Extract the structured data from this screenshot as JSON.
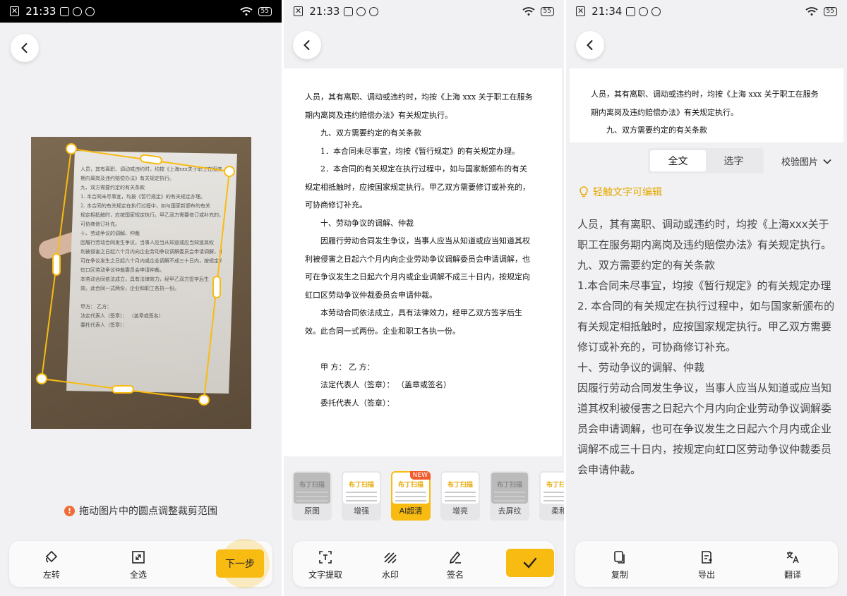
{
  "screen1": {
    "status": {
      "time": "21:33",
      "battery": "55"
    },
    "hint": "拖动图片中的圆点调整裁剪范围",
    "hint_icon": "warning-icon",
    "photo_lines": [
      "人员，其有离职、调动或违约时，均按《上海xxx关于职工在服务",
      "期内离岗及违约赔偿办法》有关规定执行。",
      "九、双方需要约定的有关条款",
      "1. 本合同未尽事宜，均按《暂行规定》的有关规定办理。",
      "2. 本合同的有关规定在执行过程中，如与国家新颁布的有关",
      "规定相抵触时，应按国家规定执行。甲乙双方需要修订或补充的，",
      "可协商修订补充。",
      "十、劳动争议的调解、仲裁",
      "因履行劳动合同发生争议，当事人应当从知道或应当知道其权",
      "利被侵害之日起六个月内向企业劳动争议调解委员会申请调解，也",
      "可在争议发生之日起六个月内或企业调解不成三十日内，按规定向",
      "虹口区劳动争议仲裁委员会申请仲裁。",
      "本劳动合同依法成立，具有法律效力，经甲乙双方签字后生",
      "效。此合同一式两份，企业和职工各执一份。",
      "",
      "甲方：  乙方：",
      "法定代表人（签章）：  （盖章或签名）",
      "委托代表人（签章）："
    ],
    "toolbar": {
      "rotate_label": "左转",
      "select_all_label": "全选",
      "next_label": "下一步"
    }
  },
  "screen2": {
    "status": {
      "time": "21:33",
      "battery": "55"
    },
    "doc": {
      "lines": [
        {
          "text": "人员，其有离职、调动或违约时，均按《上海 xxx 关于职工在服务",
          "indent": false,
          "bold": false
        },
        {
          "text": "期内离岗及违约赔偿办法》有关规定执行。",
          "indent": false,
          "bold": false
        },
        {
          "text": "九、双方需要约定的有关条款",
          "indent": true,
          "bold": false
        },
        {
          "text": "1．本合同未尽事宜，均按《暂行规定》的有关规定办理。",
          "indent": true,
          "bold": false
        },
        {
          "text": "2．本合同的有关规定在执行过程中，如与国家新颁布的有关",
          "indent": true,
          "bold": false
        },
        {
          "text": "规定相抵触时，应按国家规定执行。甲乙双方需要修订或补充的，",
          "indent": false,
          "bold": false
        },
        {
          "text": "可协商修订补充。",
          "indent": false,
          "bold": false
        },
        {
          "text": "十、劳动争议的调解、仲裁",
          "indent": true,
          "bold": false
        },
        {
          "text": "因履行劳动合同发生争议，当事人应当从知道或应当知道其权",
          "indent": true,
          "bold": false
        },
        {
          "text": "利被侵害之日起六个月内向企业劳动争议调解委员会申请调解，也",
          "indent": false,
          "bold": false
        },
        {
          "text": "可在争议发生之日起六个月内或企业调解不成三十日内，按规定向",
          "indent": false,
          "bold": false
        },
        {
          "text": "虹口区劳动争议仲裁委员会申请仲裁。",
          "indent": false,
          "bold": false
        },
        {
          "text": "本劳动合同依法成立，具有法律效力，经甲乙双方签字后生",
          "indent": true,
          "bold": false
        },
        {
          "text": "效。此合同一式两份。企业和职工各执一份。",
          "indent": false,
          "bold": false
        },
        {
          "text": "",
          "indent": false,
          "bold": false
        },
        {
          "text": "甲 方：  乙 方：",
          "indent": true,
          "bold": false
        },
        {
          "text": "法定代表人（签章）：  （盖章或签名）",
          "indent": true,
          "bold": false
        },
        {
          "text": "委托代表人（签章）：",
          "indent": true,
          "bold": false
        }
      ]
    },
    "filter_brand": "布丁扫描",
    "filters": [
      {
        "label": "原图",
        "active": false,
        "gray": true,
        "badge": ""
      },
      {
        "label": "增强",
        "active": false,
        "gray": false,
        "badge": ""
      },
      {
        "label": "AI超清",
        "active": true,
        "gray": false,
        "badge": "NEW"
      },
      {
        "label": "增亮",
        "active": false,
        "gray": false,
        "badge": ""
      },
      {
        "label": "去屏纹",
        "active": false,
        "gray": true,
        "badge": ""
      },
      {
        "label": "柔和",
        "active": false,
        "gray": false,
        "badge": ""
      }
    ],
    "toolbar": {
      "ocr_label": "文字提取",
      "watermark_label": "水印",
      "sign_label": "签名"
    }
  },
  "screen3": {
    "status": {
      "time": "21:34",
      "battery": "55"
    },
    "doc_lines": [
      {
        "text": "人员，其有离职、调动或违约时，均按《上海 xxx 关于职工在服务",
        "indent": false,
        "bold": false
      },
      {
        "text": "期内离岗及违约赔偿办法》有关规定执行。",
        "indent": false,
        "bold": false
      },
      {
        "text": "九、双方需要约定的有关条款",
        "indent": true,
        "bold": false
      }
    ],
    "tabs": {
      "full": "全文",
      "select": "选字"
    },
    "verify_label": "校验图片",
    "tip": "轻触文字可编辑",
    "ocr_text": "人员，其有离职、调动或违约时，均按《上海xxx关于职工在服务期内离岗及违约赔偿办法》有关规定执行。\n九、双方需要约定的有关条款\n1.本合同未尽事宜，均按《暂行规定》的有关规定办理\n2. 本合同的有关规定在执行过程中，如与国家新颁布的有关规定相抵触时，应按国家规定执行。甲乙双方需要修订或补充的，可协商修订补充。\n十、劳动争议的调解、仲裁\n因履行劳动合同发生争议，当事人应当从知道或应当知道其权利被侵害之日起六个月内向企业劳动争议调解委员会申请调解，也可在争议发生之日起六个月内或企业调解不成三十日内，按规定向虹口区劳动争议仲裁委员会申请仲裁。",
    "toolbar": {
      "copy_label": "复制",
      "export_label": "导出",
      "translate_label": "翻译"
    }
  }
}
